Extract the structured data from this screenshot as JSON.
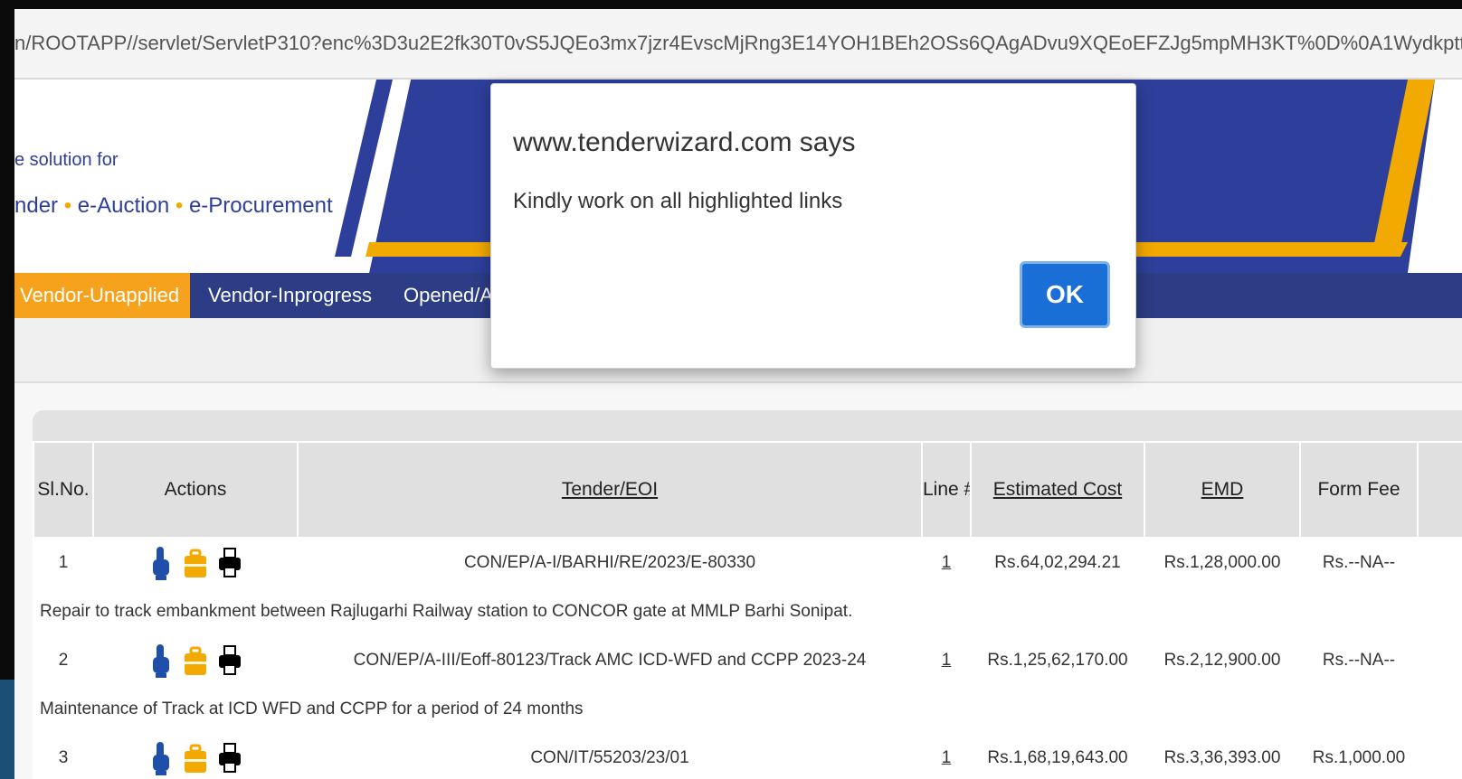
{
  "browser": {
    "url": "n/ROOTAPP//servlet/ServletP310?enc%3D3u2E2fk30T0vS5JQEo3mx7jzr4EvscMjRng3E14YOH1BEh2OSs6QAgADvu9XQEoEFZJg5mpMH3KT%0D%0A1Wydkpttop"
  },
  "banner": {
    "tagline": "e solution for",
    "products": [
      "nder",
      "e-Auction",
      "e-Procurement"
    ],
    "dot": "•"
  },
  "tabs": [
    {
      "label": "Vendor-Unapplied",
      "active": true
    },
    {
      "label": "Vendor-Inprogress",
      "active": false
    },
    {
      "label": "Opened/A",
      "active": false
    }
  ],
  "table": {
    "headers": {
      "slno": "Sl.No.",
      "actions": "Actions",
      "tender": "Tender/EOI",
      "line": "Line #",
      "cost": "Estimated Cost",
      "emd": "EMD",
      "fee": "Form Fee"
    },
    "rows": [
      {
        "slno": "1",
        "tender": "CON/EP/A-I/BARHI/RE/2023/E-80330",
        "line": "1",
        "cost": "Rs.64,02,294.21",
        "emd": "Rs.1,28,000.00",
        "fee": "Rs.--NA--",
        "description": "Repair to track embankment between Rajlugarhi Railway station to CONCOR gate at MMLP Barhi Sonipat."
      },
      {
        "slno": "2",
        "tender": "CON/EP/A-III/Eoff-80123/Track AMC ICD-WFD and CCPP 2023-24",
        "line": "1",
        "cost": "Rs.1,25,62,170.00",
        "emd": "Rs.2,12,900.00",
        "fee": "Rs.--NA--",
        "description": "Maintenance of Track at ICD WFD and CCPP for a period of 24 months"
      },
      {
        "slno": "3",
        "tender": "CON/IT/55203/23/01",
        "line": "1",
        "cost": "Rs.1,68,19,643.00",
        "emd": "Rs.3,36,393.00",
        "fee": "Rs.1,000.00",
        "description": ""
      }
    ]
  },
  "dialog": {
    "title": "www.tenderwizard.com says",
    "message": "Kindly work on all highlighted links",
    "ok_label": "OK"
  },
  "colors": {
    "brand_blue": "#2c3d85",
    "accent_orange": "#f6a21c",
    "ok_button": "#1a6fd6"
  },
  "icons": [
    "hand-pointer-icon",
    "briefcase-icon",
    "printer-icon"
  ]
}
